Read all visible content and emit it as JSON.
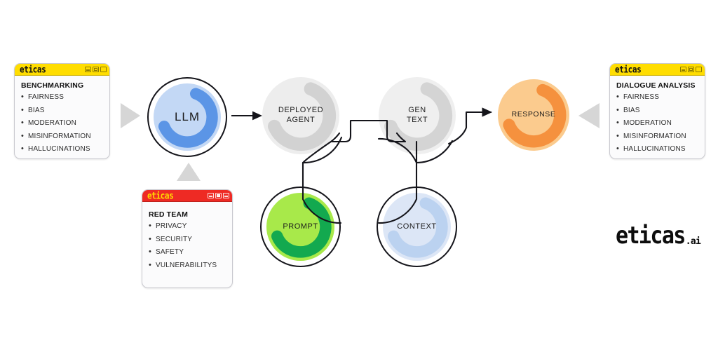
{
  "brand": {
    "window_title": "eticas",
    "logo_main": "eticas",
    "logo_tld": ".ai"
  },
  "colors": {
    "titlebar_yellow": "#FFDD00",
    "titlebar_red": "#EE2A24",
    "llm_fill": "#C3D8F5",
    "llm_swoosh": "#5B95E6",
    "agent_fill": "#EDEDED",
    "agent_swoosh": "#D2D2D2",
    "gentext_fill": "#EFEFEF",
    "gentext_swoosh": "#D4D4D4",
    "response_fill": "#FBCB8E",
    "response_swoosh": "#F5913E",
    "prompt_fill": "#A8E94A",
    "prompt_swoosh": "#13A94F",
    "context_fill": "#DCE6F6",
    "context_swoosh": "#BBD2F0",
    "triangle_gray": "#D6D6D6",
    "wire_black": "#14141A"
  },
  "panels": {
    "benchmarking": {
      "title": "eticas",
      "heading": "BENCHMARKING",
      "items": [
        "FAIRNESS",
        "BIAS",
        "MODERATION",
        "MISINFORMATION",
        "HALLUCINATIONS"
      ]
    },
    "red_team": {
      "title": "eticas",
      "heading": "RED TEAM",
      "items": [
        "PRIVACY",
        "SECURITY",
        "SAFETY",
        "VULNERABILITYS"
      ]
    },
    "dialogue_analysis": {
      "title": "eticas",
      "heading": "DIALOGUE ANALYSIS",
      "items": [
        "FAIRNESS",
        "BIAS",
        "MODERATION",
        "MISINFORMATION",
        "HALLUCINATIONS"
      ]
    }
  },
  "nodes": {
    "llm": {
      "label": "LLM"
    },
    "deployed_agent": {
      "label": "DEPLOYED\nAGENT"
    },
    "gen_text": {
      "label": "GEN\nTEXT"
    },
    "response": {
      "label": "RESPONSE"
    },
    "prompt": {
      "label": "PROMPT"
    },
    "context": {
      "label": "CONTEXT"
    }
  },
  "connectors": [
    {
      "from": "llm",
      "to": "deployed_agent",
      "style": "arrow"
    },
    {
      "from": "deployed_agent",
      "to": "gen_text",
      "style": "bracket"
    },
    {
      "from": "deployed_agent",
      "to": "prompt",
      "style": "bracket"
    },
    {
      "from": "gen_text",
      "to": "context",
      "style": "bracket"
    },
    {
      "from": "gen_text",
      "to": "response",
      "style": "arrow"
    },
    {
      "from": "benchmarking",
      "to": "llm",
      "style": "triangle-right"
    },
    {
      "from": "red_team",
      "to": "llm",
      "style": "triangle-up"
    },
    {
      "from": "dialogue_analysis",
      "to": "response",
      "style": "triangle-left"
    }
  ]
}
